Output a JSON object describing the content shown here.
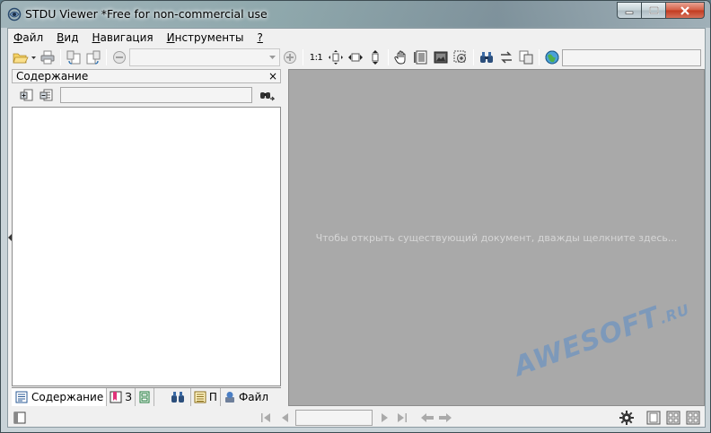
{
  "window": {
    "title": "STDU Viewer *Free for non-commercial use"
  },
  "menu": [
    {
      "label": "Файл",
      "accel": "Ф",
      "rest": "айл"
    },
    {
      "label": "Вид",
      "accel": "В",
      "rest": "ид"
    },
    {
      "label": "Навигация",
      "accel": "Н",
      "rest": "авигация"
    },
    {
      "label": "Инструменты",
      "accel": "И",
      "rest": "нструменты"
    },
    {
      "label": "?",
      "accel": "?",
      "rest": ""
    }
  ],
  "toolbar": {
    "zoom_value": "",
    "actual_size_label": "1:1",
    "search_value": ""
  },
  "left_pane": {
    "title": "Содержание",
    "close_glyph": "×",
    "search_value": "",
    "tabs": [
      {
        "label": "Содержание",
        "icon": "contents-icon"
      },
      {
        "label": "З",
        "icon": "bookmark-icon"
      },
      {
        "label": "",
        "icon": "thumbnails-icon"
      },
      {
        "label": "",
        "icon": "search-results-icon"
      },
      {
        "label": "П",
        "icon": "pages-icon"
      },
      {
        "label": "Файл",
        "icon": "file-icon"
      }
    ]
  },
  "document": {
    "hint": "Чтобы открыть существующий документ, дважды щелкните здесь..."
  },
  "watermark": {
    "main": "AWESOFT",
    "suffix": ".RU"
  },
  "statusbar": {
    "page_value": ""
  },
  "colors": {
    "doc_background": "#a9a9a9",
    "hint_text": "#d6d6d6",
    "close_button": "#c23a1f"
  }
}
